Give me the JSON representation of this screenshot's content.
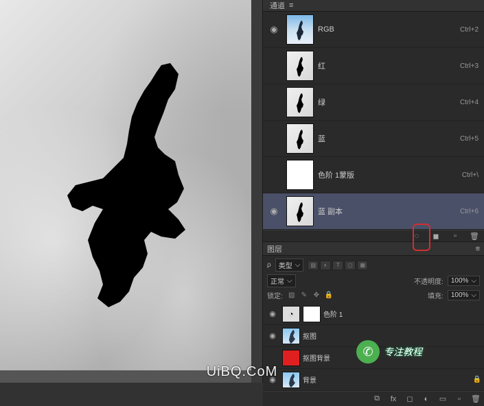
{
  "panels": {
    "channels_title": "通道",
    "layers_title": "图层"
  },
  "channels": [
    {
      "name": "RGB",
      "shortcut": "Ctrl+2",
      "visible": true,
      "thumb": "rgb"
    },
    {
      "name": "红",
      "shortcut": "Ctrl+3",
      "visible": false,
      "thumb": "gray"
    },
    {
      "name": "绿",
      "shortcut": "Ctrl+4",
      "visible": false,
      "thumb": "gray"
    },
    {
      "name": "蓝",
      "shortcut": "Ctrl+5",
      "visible": false,
      "thumb": "gray"
    },
    {
      "name": "色阶 1蒙版",
      "shortcut": "Ctrl+\\",
      "visible": false,
      "thumb": "white"
    },
    {
      "name": "蓝 副本",
      "shortcut": "Ctrl+6",
      "visible": true,
      "thumb": "gray",
      "selected": true
    }
  ],
  "layers_controls": {
    "kind_label": "类型",
    "blend_mode": "正常",
    "opacity_label": "不透明度:",
    "opacity_value": "100%",
    "lock_label": "锁定:",
    "fill_label": "填充:",
    "fill_value": "100%"
  },
  "layers": [
    {
      "name": "色阶 1",
      "type": "adjustment",
      "visible": true
    },
    {
      "name": "抠图",
      "type": "image",
      "visible": true
    },
    {
      "name": "抠图背景",
      "type": "solid-red",
      "visible": false
    },
    {
      "name": "背景",
      "type": "image",
      "visible": true,
      "locked": true
    }
  ],
  "watermark": {
    "brand": "专注教程",
    "url": "UiBQ.CoM"
  }
}
